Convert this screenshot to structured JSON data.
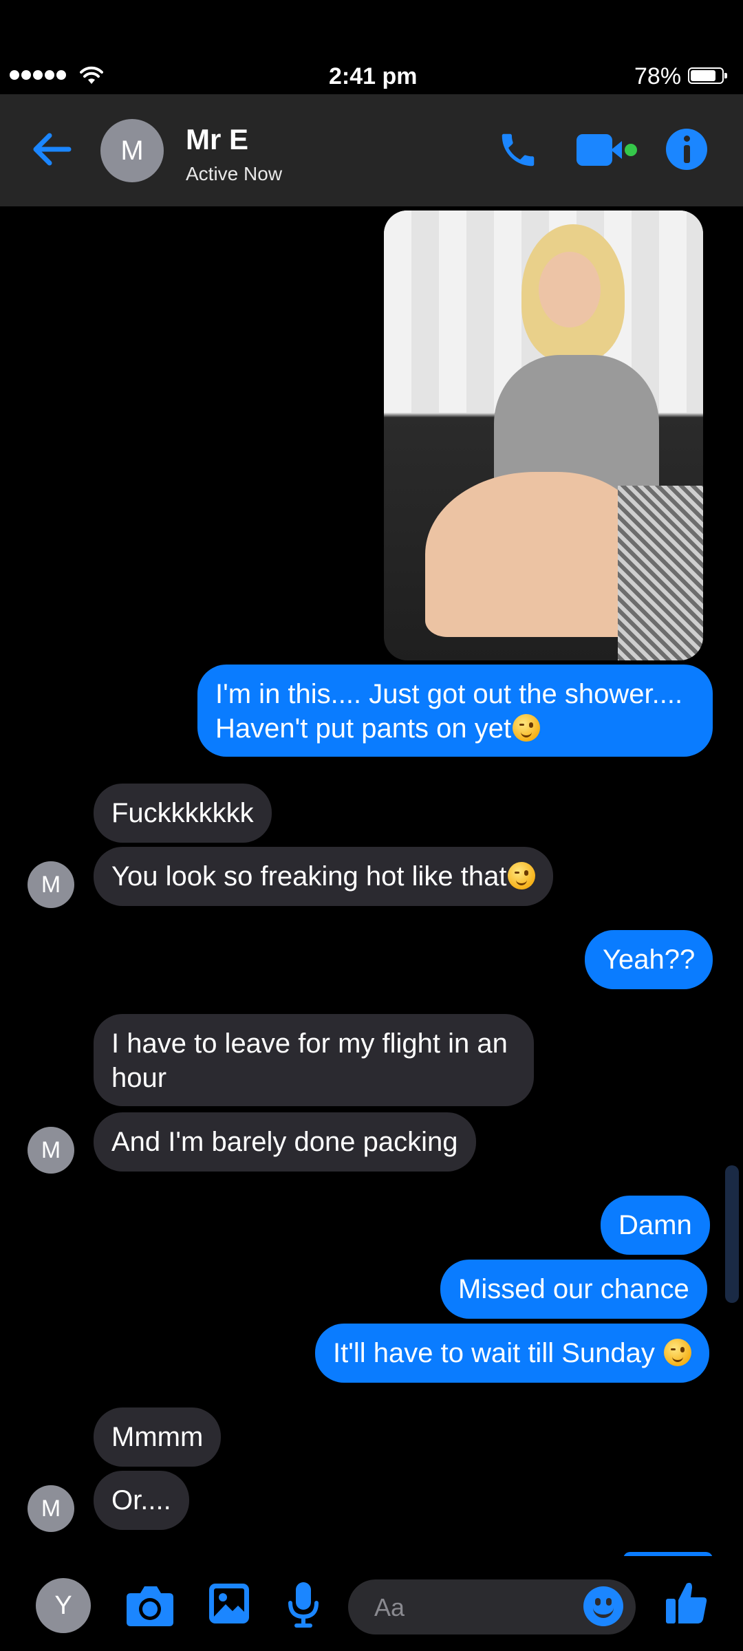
{
  "status_bar": {
    "time": "2:41 pm",
    "battery": "78%",
    "signal_dots": 5
  },
  "header": {
    "contact_name": "Mr E",
    "contact_status": "Active Now",
    "avatar_initial": "M"
  },
  "messages": [
    {
      "side": "in",
      "text": "Fuckkkkkkk"
    },
    {
      "side": "in",
      "text": "You look so freaking hot like that",
      "emoji": true
    },
    {
      "side": "out",
      "text": "Yeah??"
    },
    {
      "side": "in",
      "line1": "I have to leave for my flight in an",
      "line2": "hour"
    },
    {
      "side": "in",
      "text": "And I'm barely done packing"
    },
    {
      "side": "out",
      "text": "Damn"
    },
    {
      "side": "out",
      "text": "Missed our chance"
    },
    {
      "side": "out",
      "text": "It'll have to wait till Sunday ",
      "emoji": true
    },
    {
      "side": "in",
      "text": "Mmmm"
    },
    {
      "side": "in",
      "text": "Or...."
    }
  ],
  "photo_caption": {
    "line1": "I'm in this.... Just got out the shower....",
    "line2": "Haven't put pants on yet"
  },
  "composer": {
    "placeholder": "Aa",
    "user_initial": "Y"
  },
  "colors": {
    "accent": "#0a7cff",
    "incoming_bubble": "#2b2a30",
    "header_bg": "#262626"
  }
}
